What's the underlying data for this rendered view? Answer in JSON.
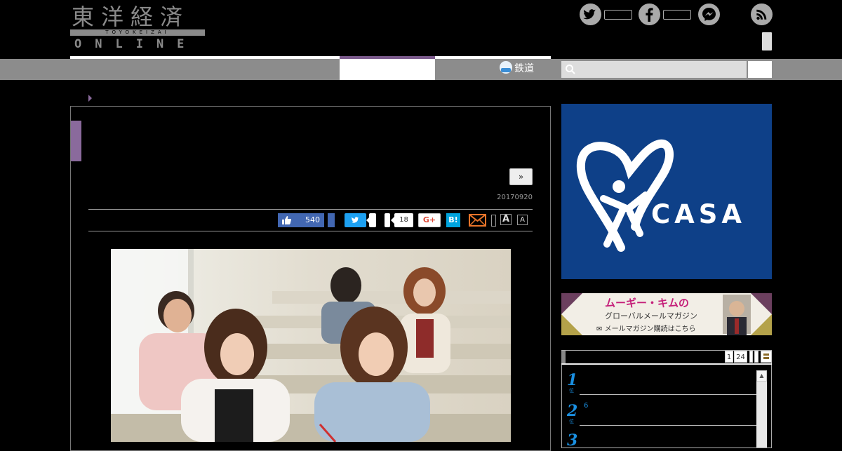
{
  "logo": {
    "kanji": "東洋経済",
    "sub": "TOYOKEIZAI",
    "online": "ONLINE"
  },
  "header": {
    "social_icons": [
      "twitter-icon",
      "facebook-icon",
      "messenger-icon",
      "rss-icon"
    ]
  },
  "nav": {
    "tetsudo_label": "鉄道",
    "search_placeholder": ""
  },
  "article": {
    "next_label": "»",
    "date": "20170920",
    "share": {
      "fb_like_count": "540",
      "pocket_count": "18",
      "gplus_label": "G+",
      "hatena_label": "B!",
      "font_large": "A",
      "font_small": "A"
    }
  },
  "sidebar": {
    "casa": {
      "brand": "CASA",
      "registered": "®"
    },
    "kim_ad": {
      "line1": "ムーギー・キムの",
      "line2": "グローバルメールマガジン",
      "line3": "メールマガジン購読はこちら"
    },
    "ranking": {
      "tabs": [
        "1",
        "24",
        "",
        "",
        "〓"
      ],
      "items": [
        {
          "rank": "1",
          "suffix": "位",
          "text": ""
        },
        {
          "rank": "2",
          "suffix": "位",
          "text": "6"
        },
        {
          "rank": "3",
          "suffix": "位",
          "text": ""
        }
      ],
      "scroll_up": "▲"
    }
  },
  "colors": {
    "nav_gray": "#8c8c8c",
    "accent_purple": "#8a6a9c",
    "casa_blue": "#0e4088",
    "facebook": "#4267b2",
    "twitter": "#1da1f2",
    "hatena": "#00a4de",
    "rank_blue": "#1a8fe0"
  }
}
